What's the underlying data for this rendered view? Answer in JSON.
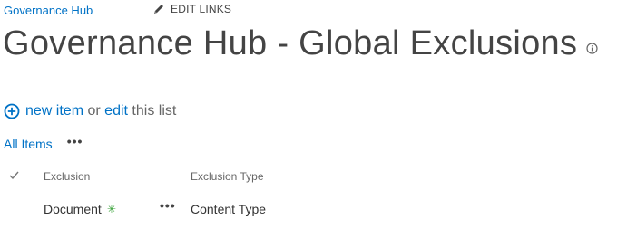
{
  "topbar": {
    "site_name": "Governance Hub",
    "edit_links_label": "EDIT LINKS"
  },
  "page": {
    "title": "Governance Hub - Global Exclusions"
  },
  "actions": {
    "new_item_label": "new item",
    "or_text": "or",
    "edit_label": "edit",
    "this_list_text": "this list"
  },
  "views": {
    "current_view": "All Items",
    "more_label": "•••"
  },
  "table": {
    "columns": [
      "Exclusion",
      "Exclusion Type"
    ],
    "rows": [
      {
        "exclusion": "Document",
        "new_marker": "✳",
        "row_menu": "•••",
        "exclusion_type": "Content Type"
      }
    ]
  },
  "colors": {
    "link": "#0072c6",
    "text": "#444444",
    "new_marker": "#3aa33a"
  },
  "icons": {
    "edit_links": "pencil-icon",
    "title_info": "info-icon",
    "new_item": "plus-circle-icon",
    "select_all": "checkmark-icon",
    "new_marker": "new-item-icon"
  }
}
